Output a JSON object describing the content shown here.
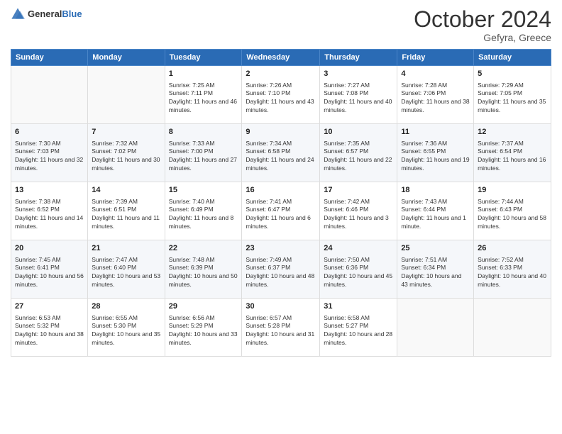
{
  "header": {
    "logo_general": "General",
    "logo_blue": "Blue",
    "month_title": "October 2024",
    "location": "Gefyra, Greece"
  },
  "days_of_week": [
    "Sunday",
    "Monday",
    "Tuesday",
    "Wednesday",
    "Thursday",
    "Friday",
    "Saturday"
  ],
  "weeks": [
    [
      {
        "day": "",
        "sunrise": "",
        "sunset": "",
        "daylight": ""
      },
      {
        "day": "",
        "sunrise": "",
        "sunset": "",
        "daylight": ""
      },
      {
        "day": "1",
        "sunrise": "Sunrise: 7:25 AM",
        "sunset": "Sunset: 7:11 PM",
        "daylight": "Daylight: 11 hours and 46 minutes."
      },
      {
        "day": "2",
        "sunrise": "Sunrise: 7:26 AM",
        "sunset": "Sunset: 7:10 PM",
        "daylight": "Daylight: 11 hours and 43 minutes."
      },
      {
        "day": "3",
        "sunrise": "Sunrise: 7:27 AM",
        "sunset": "Sunset: 7:08 PM",
        "daylight": "Daylight: 11 hours and 40 minutes."
      },
      {
        "day": "4",
        "sunrise": "Sunrise: 7:28 AM",
        "sunset": "Sunset: 7:06 PM",
        "daylight": "Daylight: 11 hours and 38 minutes."
      },
      {
        "day": "5",
        "sunrise": "Sunrise: 7:29 AM",
        "sunset": "Sunset: 7:05 PM",
        "daylight": "Daylight: 11 hours and 35 minutes."
      }
    ],
    [
      {
        "day": "6",
        "sunrise": "Sunrise: 7:30 AM",
        "sunset": "Sunset: 7:03 PM",
        "daylight": "Daylight: 11 hours and 32 minutes."
      },
      {
        "day": "7",
        "sunrise": "Sunrise: 7:32 AM",
        "sunset": "Sunset: 7:02 PM",
        "daylight": "Daylight: 11 hours and 30 minutes."
      },
      {
        "day": "8",
        "sunrise": "Sunrise: 7:33 AM",
        "sunset": "Sunset: 7:00 PM",
        "daylight": "Daylight: 11 hours and 27 minutes."
      },
      {
        "day": "9",
        "sunrise": "Sunrise: 7:34 AM",
        "sunset": "Sunset: 6:58 PM",
        "daylight": "Daylight: 11 hours and 24 minutes."
      },
      {
        "day": "10",
        "sunrise": "Sunrise: 7:35 AM",
        "sunset": "Sunset: 6:57 PM",
        "daylight": "Daylight: 11 hours and 22 minutes."
      },
      {
        "day": "11",
        "sunrise": "Sunrise: 7:36 AM",
        "sunset": "Sunset: 6:55 PM",
        "daylight": "Daylight: 11 hours and 19 minutes."
      },
      {
        "day": "12",
        "sunrise": "Sunrise: 7:37 AM",
        "sunset": "Sunset: 6:54 PM",
        "daylight": "Daylight: 11 hours and 16 minutes."
      }
    ],
    [
      {
        "day": "13",
        "sunrise": "Sunrise: 7:38 AM",
        "sunset": "Sunset: 6:52 PM",
        "daylight": "Daylight: 11 hours and 14 minutes."
      },
      {
        "day": "14",
        "sunrise": "Sunrise: 7:39 AM",
        "sunset": "Sunset: 6:51 PM",
        "daylight": "Daylight: 11 hours and 11 minutes."
      },
      {
        "day": "15",
        "sunrise": "Sunrise: 7:40 AM",
        "sunset": "Sunset: 6:49 PM",
        "daylight": "Daylight: 11 hours and 8 minutes."
      },
      {
        "day": "16",
        "sunrise": "Sunrise: 7:41 AM",
        "sunset": "Sunset: 6:47 PM",
        "daylight": "Daylight: 11 hours and 6 minutes."
      },
      {
        "day": "17",
        "sunrise": "Sunrise: 7:42 AM",
        "sunset": "Sunset: 6:46 PM",
        "daylight": "Daylight: 11 hours and 3 minutes."
      },
      {
        "day": "18",
        "sunrise": "Sunrise: 7:43 AM",
        "sunset": "Sunset: 6:44 PM",
        "daylight": "Daylight: 11 hours and 1 minute."
      },
      {
        "day": "19",
        "sunrise": "Sunrise: 7:44 AM",
        "sunset": "Sunset: 6:43 PM",
        "daylight": "Daylight: 10 hours and 58 minutes."
      }
    ],
    [
      {
        "day": "20",
        "sunrise": "Sunrise: 7:45 AM",
        "sunset": "Sunset: 6:41 PM",
        "daylight": "Daylight: 10 hours and 56 minutes."
      },
      {
        "day": "21",
        "sunrise": "Sunrise: 7:47 AM",
        "sunset": "Sunset: 6:40 PM",
        "daylight": "Daylight: 10 hours and 53 minutes."
      },
      {
        "day": "22",
        "sunrise": "Sunrise: 7:48 AM",
        "sunset": "Sunset: 6:39 PM",
        "daylight": "Daylight: 10 hours and 50 minutes."
      },
      {
        "day": "23",
        "sunrise": "Sunrise: 7:49 AM",
        "sunset": "Sunset: 6:37 PM",
        "daylight": "Daylight: 10 hours and 48 minutes."
      },
      {
        "day": "24",
        "sunrise": "Sunrise: 7:50 AM",
        "sunset": "Sunset: 6:36 PM",
        "daylight": "Daylight: 10 hours and 45 minutes."
      },
      {
        "day": "25",
        "sunrise": "Sunrise: 7:51 AM",
        "sunset": "Sunset: 6:34 PM",
        "daylight": "Daylight: 10 hours and 43 minutes."
      },
      {
        "day": "26",
        "sunrise": "Sunrise: 7:52 AM",
        "sunset": "Sunset: 6:33 PM",
        "daylight": "Daylight: 10 hours and 40 minutes."
      }
    ],
    [
      {
        "day": "27",
        "sunrise": "Sunrise: 6:53 AM",
        "sunset": "Sunset: 5:32 PM",
        "daylight": "Daylight: 10 hours and 38 minutes."
      },
      {
        "day": "28",
        "sunrise": "Sunrise: 6:55 AM",
        "sunset": "Sunset: 5:30 PM",
        "daylight": "Daylight: 10 hours and 35 minutes."
      },
      {
        "day": "29",
        "sunrise": "Sunrise: 6:56 AM",
        "sunset": "Sunset: 5:29 PM",
        "daylight": "Daylight: 10 hours and 33 minutes."
      },
      {
        "day": "30",
        "sunrise": "Sunrise: 6:57 AM",
        "sunset": "Sunset: 5:28 PM",
        "daylight": "Daylight: 10 hours and 31 minutes."
      },
      {
        "day": "31",
        "sunrise": "Sunrise: 6:58 AM",
        "sunset": "Sunset: 5:27 PM",
        "daylight": "Daylight: 10 hours and 28 minutes."
      },
      {
        "day": "",
        "sunrise": "",
        "sunset": "",
        "daylight": ""
      },
      {
        "day": "",
        "sunrise": "",
        "sunset": "",
        "daylight": ""
      }
    ]
  ]
}
